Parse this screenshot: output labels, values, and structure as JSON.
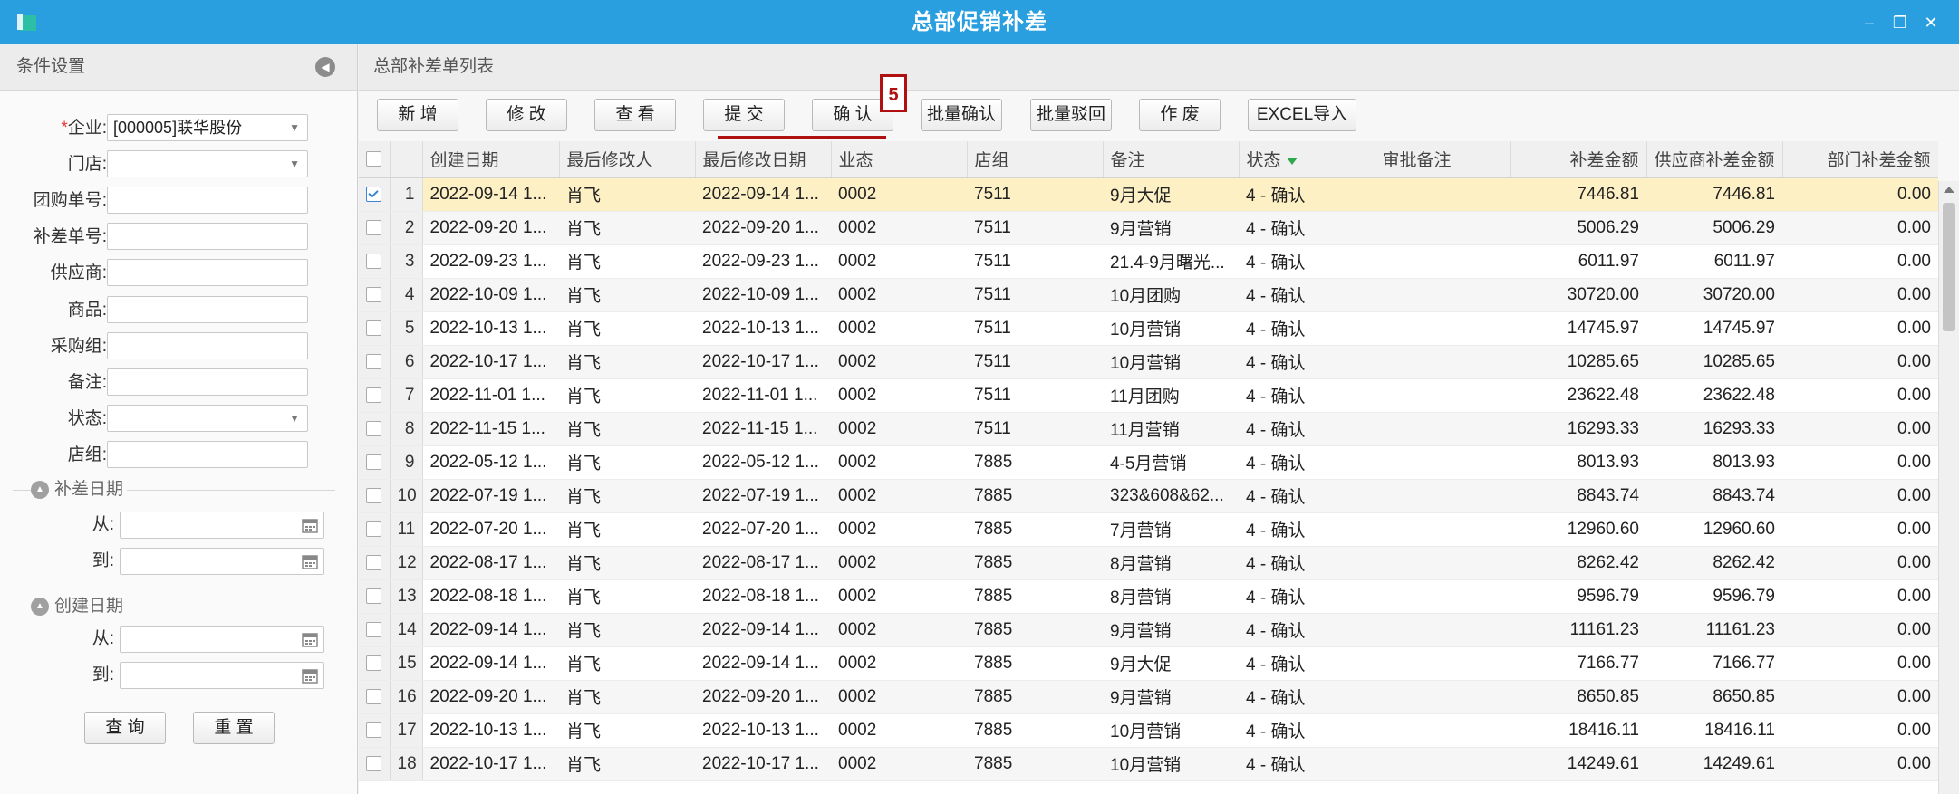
{
  "window": {
    "title": "总部促销补差",
    "minimize": "–",
    "restore": "❐",
    "close": "✕"
  },
  "left": {
    "title": "条件设置",
    "fields": [
      {
        "label": "企业:",
        "value": "[000005]联华股份",
        "required": "*",
        "dropdown": true
      },
      {
        "label": "门店:",
        "value": "",
        "dropdown": true
      },
      {
        "label": "团购单号:",
        "value": ""
      },
      {
        "label": "补差单号:",
        "value": ""
      },
      {
        "label": "供应商:",
        "value": ""
      },
      {
        "label": "商品:",
        "value": ""
      },
      {
        "label": "采购组:",
        "value": ""
      },
      {
        "label": "备注:",
        "value": ""
      },
      {
        "label": "状态:",
        "value": "",
        "dropdown": true
      },
      {
        "label": "店组:",
        "value": ""
      }
    ],
    "groups": [
      {
        "title": "补差日期",
        "from": "从:",
        "to": "到:"
      },
      {
        "title": "创建日期",
        "from": "从:",
        "to": "到:"
      }
    ],
    "query_label": "查 询",
    "reset_label": "重 置"
  },
  "right": {
    "title": "总部补差单列表",
    "toolbar": [
      "新 增",
      "修 改",
      "查 看",
      "提 交",
      "确 认",
      "批量确认",
      "批量驳回",
      "作 废",
      "EXCEL导入"
    ],
    "annotation": "5"
  },
  "table": {
    "columns": [
      "创建日期",
      "最后修改人",
      "最后修改日期",
      "业态",
      "店组",
      "备注",
      "状态",
      "审批备注",
      "补差金额",
      "供应商补差金额",
      "部门补差金额"
    ],
    "rows": [
      [
        "1",
        "2022-09-14 1...",
        "肖飞",
        "2022-09-14 1...",
        "0002",
        "7511",
        "9月大促",
        "4 - 确认",
        "",
        "7446.81",
        "7446.81",
        "0.00"
      ],
      [
        "2",
        "2022-09-20 1...",
        "肖飞",
        "2022-09-20 1...",
        "0002",
        "7511",
        "9月营销",
        "4 - 确认",
        "",
        "5006.29",
        "5006.29",
        "0.00"
      ],
      [
        "3",
        "2022-09-23 1...",
        "肖飞",
        "2022-09-23 1...",
        "0002",
        "7511",
        "21.4-9月曙光...",
        "4 - 确认",
        "",
        "6011.97",
        "6011.97",
        "0.00"
      ],
      [
        "4",
        "2022-10-09 1...",
        "肖飞",
        "2022-10-09 1...",
        "0002",
        "7511",
        "10月团购",
        "4 - 确认",
        "",
        "30720.00",
        "30720.00",
        "0.00"
      ],
      [
        "5",
        "2022-10-13 1...",
        "肖飞",
        "2022-10-13 1...",
        "0002",
        "7511",
        "10月营销",
        "4 - 确认",
        "",
        "14745.97",
        "14745.97",
        "0.00"
      ],
      [
        "6",
        "2022-10-17 1...",
        "肖飞",
        "2022-10-17 1...",
        "0002",
        "7511",
        "10月营销",
        "4 - 确认",
        "",
        "10285.65",
        "10285.65",
        "0.00"
      ],
      [
        "7",
        "2022-11-01 1...",
        "肖飞",
        "2022-11-01 1...",
        "0002",
        "7511",
        "11月团购",
        "4 - 确认",
        "",
        "23622.48",
        "23622.48",
        "0.00"
      ],
      [
        "8",
        "2022-11-15 1...",
        "肖飞",
        "2022-11-15 1...",
        "0002",
        "7511",
        "11月营销",
        "4 - 确认",
        "",
        "16293.33",
        "16293.33",
        "0.00"
      ],
      [
        "9",
        "2022-05-12 1...",
        "肖飞",
        "2022-05-12 1...",
        "0002",
        "7885",
        "4-5月营销",
        "4 - 确认",
        "",
        "8013.93",
        "8013.93",
        "0.00"
      ],
      [
        "10",
        "2022-07-19 1...",
        "肖飞",
        "2022-07-19 1...",
        "0002",
        "7885",
        "323&608&62...",
        "4 - 确认",
        "",
        "8843.74",
        "8843.74",
        "0.00"
      ],
      [
        "11",
        "2022-07-20 1...",
        "肖飞",
        "2022-07-20 1...",
        "0002",
        "7885",
        "7月营销",
        "4 - 确认",
        "",
        "12960.60",
        "12960.60",
        "0.00"
      ],
      [
        "12",
        "2022-08-17 1...",
        "肖飞",
        "2022-08-17 1...",
        "0002",
        "7885",
        "8月营销",
        "4 - 确认",
        "",
        "8262.42",
        "8262.42",
        "0.00"
      ],
      [
        "13",
        "2022-08-18 1...",
        "肖飞",
        "2022-08-18 1...",
        "0002",
        "7885",
        "8月营销",
        "4 - 确认",
        "",
        "9596.79",
        "9596.79",
        "0.00"
      ],
      [
        "14",
        "2022-09-14 1...",
        "肖飞",
        "2022-09-14 1...",
        "0002",
        "7885",
        "9月营销",
        "4 - 确认",
        "",
        "11161.23",
        "11161.23",
        "0.00"
      ],
      [
        "15",
        "2022-09-14 1...",
        "肖飞",
        "2022-09-14 1...",
        "0002",
        "7885",
        "9月大促",
        "4 - 确认",
        "",
        "7166.77",
        "7166.77",
        "0.00"
      ],
      [
        "16",
        "2022-09-20 1...",
        "肖飞",
        "2022-09-20 1...",
        "0002",
        "7885",
        "9月营销",
        "4 - 确认",
        "",
        "8650.85",
        "8650.85",
        "0.00"
      ],
      [
        "17",
        "2022-10-13 1...",
        "肖飞",
        "2022-10-13 1...",
        "0002",
        "7885",
        "10月营销",
        "4 - 确认",
        "",
        "18416.11",
        "18416.11",
        "0.00"
      ],
      [
        "18",
        "2022-10-17 1...",
        "肖飞",
        "2022-10-17 1...",
        "0002",
        "7885",
        "10月营销",
        "4 - 确认",
        "",
        "14249.61",
        "14249.61",
        "0.00"
      ]
    ],
    "selected_row": 1
  }
}
